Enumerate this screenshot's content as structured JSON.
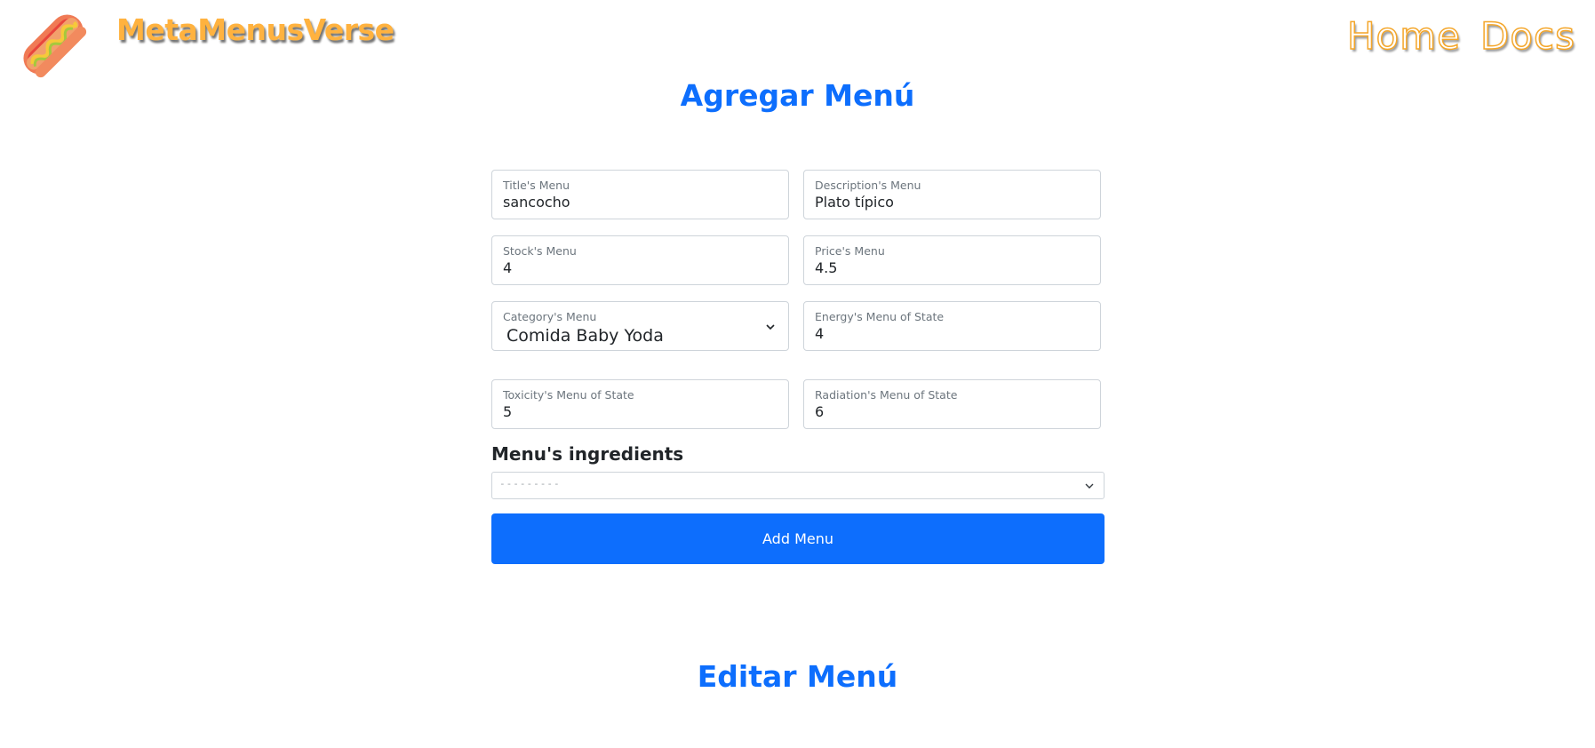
{
  "header": {
    "brand": "MetaMenusVerse",
    "logo_icon": "hotdog-icon",
    "nav": {
      "home": "Home",
      "docs": "Docs"
    }
  },
  "add_section": {
    "title": "Agregar Menú",
    "fields": {
      "title": {
        "label": "Title's Menu",
        "value": "sancocho"
      },
      "description": {
        "label": "Description's Menu",
        "value": "Plato típico"
      },
      "stock": {
        "label": "Stock's Menu",
        "value": "4"
      },
      "price": {
        "label": "Price's Menu",
        "value": "4.5"
      },
      "category": {
        "label": "Category's Menu",
        "value": "Comida Baby Yoda"
      },
      "energy": {
        "label": "Energy's Menu of State",
        "value": "4"
      },
      "toxicity": {
        "label": "Toxicity's Menu of State",
        "value": "5"
      },
      "radiation": {
        "label": "Radiation's Menu of State",
        "value": "6"
      }
    },
    "ingredients": {
      "label": "Menu's ingredients",
      "selected": "---------"
    },
    "submit_label": "Add Menu"
  },
  "edit_section": {
    "title": "Editar Menú"
  },
  "colors": {
    "primary": "#0d6efd",
    "brand": "#ffb23f",
    "nav_stroke": "#f4a62a"
  }
}
